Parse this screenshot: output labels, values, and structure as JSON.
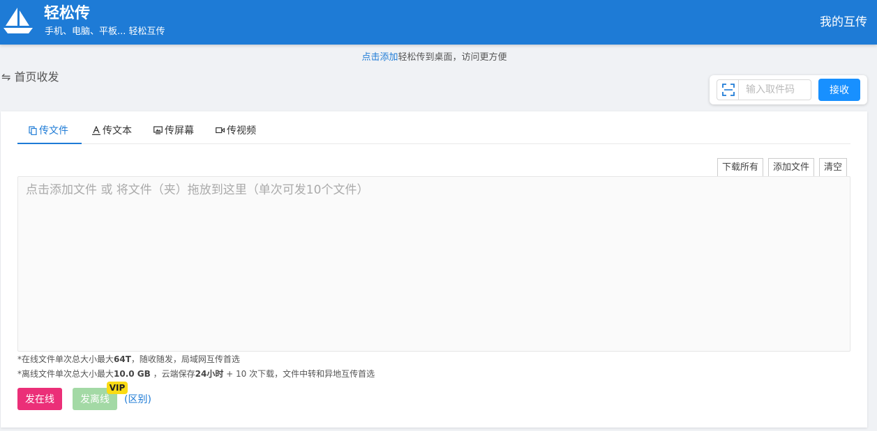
{
  "header": {
    "title": "轻松传",
    "subtitle": "手机、电脑、平板... 轻松互传",
    "my_transfers": "我的互传",
    "logo_icon": "sailboat-icon"
  },
  "tip": {
    "link": "点击添加",
    "text": "轻松传到桌面，访问更方便"
  },
  "breadcrumb": {
    "icon": "swap-arrows-icon",
    "label": "首页收发"
  },
  "receive": {
    "scan_icon": "scan-icon",
    "placeholder": "输入取件码",
    "button": "接收"
  },
  "tabs": [
    {
      "label": "传文件",
      "icon": "files-icon",
      "active": true
    },
    {
      "label": "传文本",
      "icon": "text-icon",
      "active": false
    },
    {
      "label": "传屏幕",
      "icon": "screen-icon",
      "active": false
    },
    {
      "label": "传视频",
      "icon": "video-icon",
      "active": false
    }
  ],
  "toolbar": {
    "download_all": "下载所有",
    "add_file": "添加文件",
    "clear": "清空"
  },
  "dropzone": {
    "text": "点击添加文件 或 将文件（夹）拖放到这里（单次可发10个文件）"
  },
  "notes": {
    "online_a": "*在线文件单次总大小最大",
    "online_b": "64T",
    "online_c": "，随收随发，局域网互传首选",
    "offline_a": "*离线文件单次总大小最大",
    "offline_b": "10.0 GB",
    "offline_c": " ，云端保存",
    "offline_d": "24小时",
    "offline_e": " + 10 次下载，文件中转和异地互传首选"
  },
  "actions": {
    "send_online": "发在线",
    "send_offline": "发离线",
    "vip": "VIP",
    "difference": "(区别)"
  },
  "colors": {
    "brand": "#1e7bd6",
    "receive_button": "#1890ff",
    "online_button": "#eb2f78",
    "offline_button": "#a3d9a5",
    "vip_badge": "#fadb14"
  }
}
